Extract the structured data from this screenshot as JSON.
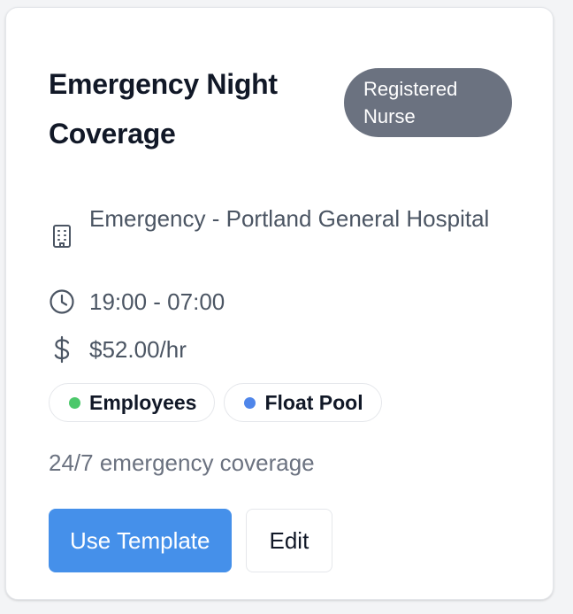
{
  "template": {
    "title": "Emergency Night Coverage",
    "role": "Registered Nurse",
    "location": "Emergency - Portland General Hospital",
    "hours": "19:00 - 07:00",
    "pay": "$52.00/hr",
    "tags": [
      {
        "label": "Employees",
        "color": "#4cc86b"
      },
      {
        "label": "Float Pool",
        "color": "#4f86ea"
      }
    ],
    "note": "24/7 emergency coverage"
  },
  "actions": {
    "use_template_label": "Use Template",
    "edit_label": "Edit"
  },
  "icons": {
    "location": "building-icon",
    "hours": "clock-icon",
    "pay": "dollar-icon"
  },
  "colors": {
    "primary": "#4590ea",
    "badge": "#6b7280"
  }
}
